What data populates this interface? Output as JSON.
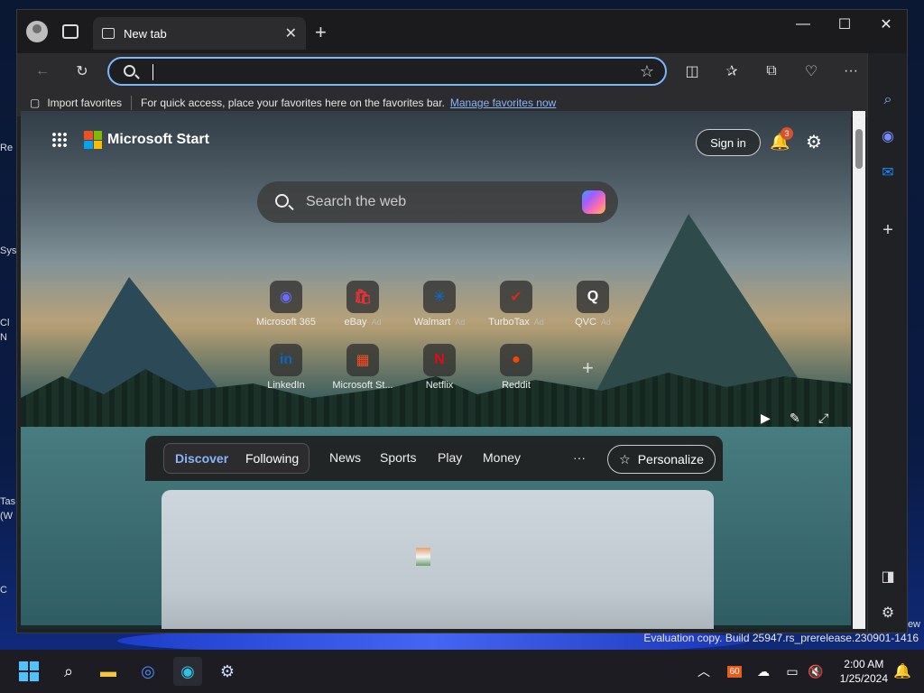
{
  "desktop": {
    "icons": [
      "Re",
      "Sys",
      "Cl",
      "N",
      "Tas",
      "(W",
      "C"
    ],
    "new_label": "ew",
    "eval_text": "Evaluation copy. Build 25947.rs_prerelease.230901-1416"
  },
  "browser": {
    "tab_title": "New tab",
    "tab_close": "✕",
    "new_tab": "+",
    "window_controls": {
      "minimize": "—",
      "maximize": "☐",
      "close": "✕"
    },
    "address_value": "",
    "favorites_bar": {
      "import_label": "Import favorites",
      "hint": "For quick access, place your favorites here on the favorites bar.",
      "manage_link": "Manage favorites now"
    }
  },
  "start_page": {
    "brand": "Microsoft Start",
    "sign_in": "Sign in",
    "notification_count": "3",
    "search_placeholder": "Search the web",
    "tiles": [
      {
        "label": "Microsoft 365",
        "ad": "",
        "glyph": "◉",
        "color": "#6b6bff"
      },
      {
        "label": "eBay",
        "ad": "· Ad",
        "glyph": "🛍",
        "color": "#e53238"
      },
      {
        "label": "Walmart",
        "ad": "· Ad",
        "glyph": "✳",
        "color": "#0071dc"
      },
      {
        "label": "TurboTax",
        "ad": "· Ad",
        "glyph": "✔",
        "color": "#d52b1e"
      },
      {
        "label": "QVC",
        "ad": "· Ad",
        "glyph": "Q",
        "color": "#ffffff"
      },
      {
        "label": "LinkedIn",
        "ad": "",
        "glyph": "in",
        "color": "#0a66c2"
      },
      {
        "label": "Microsoft St...",
        "ad": "",
        "glyph": "▦",
        "color": "#f25022"
      },
      {
        "label": "Netflix",
        "ad": "",
        "glyph": "N",
        "color": "#e50914"
      },
      {
        "label": "Reddit",
        "ad": "",
        "glyph": "●",
        "color": "#ff4500"
      }
    ],
    "feed": {
      "discover": "Discover",
      "following": "Following",
      "tabs": [
        "News",
        "Sports",
        "Play",
        "Money"
      ],
      "more": "···",
      "personalize": "Personalize"
    }
  },
  "taskbar": {
    "time": "2:00 AM",
    "date": "1/25/2024",
    "tray_badge": "60"
  }
}
